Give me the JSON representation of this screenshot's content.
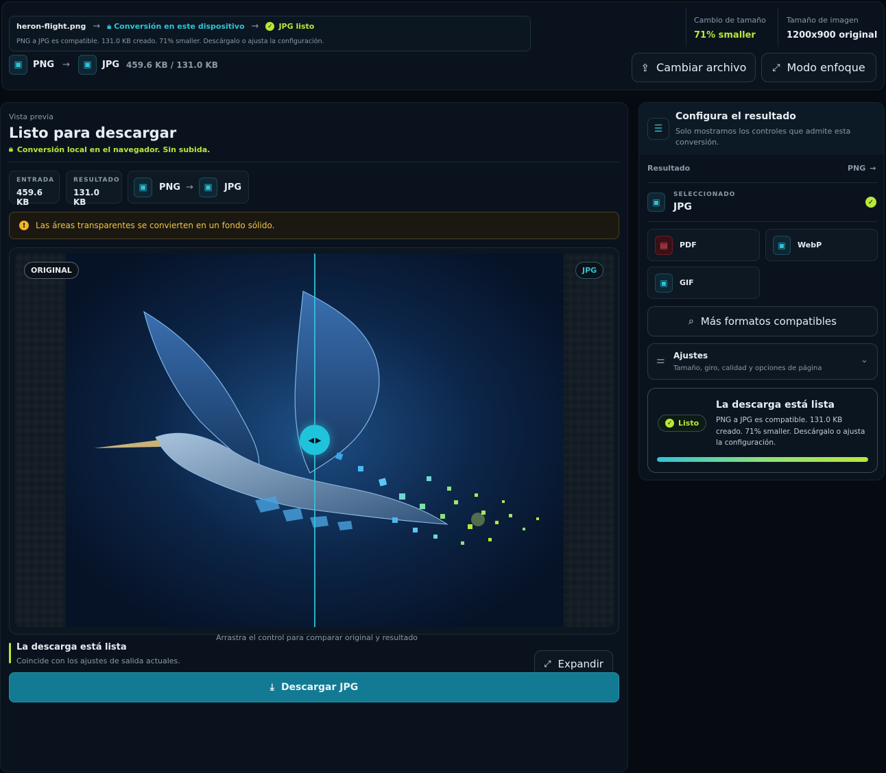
{
  "header": {
    "filename": "heron-flight.png",
    "step_local": "Conversión en este dispositivo",
    "step_ready": "JPG listo",
    "summary": "PNG a JPG es compatible. 131.0 KB creado. 71% smaller. Descárgalo o ajusta la configuración.",
    "from_format": "PNG",
    "to_format": "JPG",
    "size_pair": "459.6 KB / 131.0 KB",
    "size_change_label": "Cambio de tamaño",
    "size_change_value": "71% smaller",
    "image_size_label": "Tamaño de imagen",
    "image_size_value": "1200x900 original",
    "change_file_label": "Cambiar archivo",
    "focus_mode_label": "Modo enfoque"
  },
  "preview": {
    "eyebrow": "Vista previa",
    "title": "Listo para descargar",
    "local_note": "Conversión local en el navegador. Sin subida.",
    "input_label": "ENTRADA",
    "input_value": "459.6 KB",
    "result_label": "RESULTADO",
    "result_value": "131.0 KB",
    "from_format": "PNG",
    "to_format": "JPG",
    "warning": "Las áreas transparentes se convierten en un fondo sólido.",
    "tag_original": "ORIGINAL",
    "tag_result": "JPG",
    "hint": "Arrastra el control para comparar original y resultado",
    "status_title": "La descarga está lista",
    "status_sub": "Coincide con los ajustes de salida actuales.",
    "expand_label": "Expandir",
    "download_label": "Descargar JPG",
    "slider_position": 0.5
  },
  "config": {
    "title": "Configura el resultado",
    "subtitle": "Solo mostramos los controles que admite esta conversión.",
    "result_label": "Resultado",
    "result_source": "PNG",
    "selected_label": "SELECCIONADO",
    "selected_value": "JPG",
    "formats": [
      "PDF",
      "WebP",
      "GIF"
    ],
    "more_formats": "Más formatos compatibles",
    "settings_title": "Ajustes",
    "settings_sub": "Tamaño, giro, calidad y opciones de página",
    "ready_title": "La descarga está lista",
    "ready_pill": "Listo",
    "ready_text": "PNG a JPG es compatible. 131.0 KB creado. 71% smaller. Descárgalo o ajusta la configuración.",
    "progress": 1.0
  },
  "colors": {
    "accent": "#2ec4d6",
    "lime": "#b8e839",
    "warning": "#f0c24a",
    "danger": "#f25a6a",
    "download": "#137a93"
  }
}
